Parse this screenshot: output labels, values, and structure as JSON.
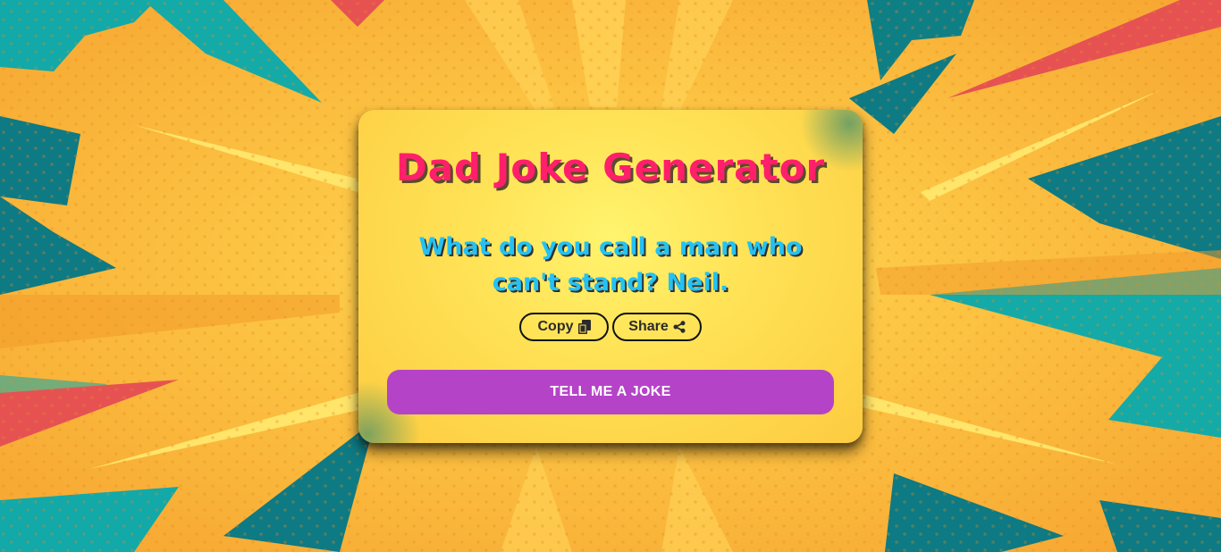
{
  "app": {
    "title": "Dad Joke Generator"
  },
  "joke": {
    "text": "What do you call a man who can't stand? Neil."
  },
  "actions": {
    "copy_label": "Copy",
    "share_label": "Share",
    "tell_label": "TELL ME A JOKE"
  },
  "icons": {
    "copy": "copy-icon",
    "share": "share-icon"
  },
  "colors": {
    "title": "#ff1f6a",
    "joke": "#24c2f4",
    "button": "#b543c8",
    "card": "#ffe357",
    "background": "#f7b23b"
  }
}
